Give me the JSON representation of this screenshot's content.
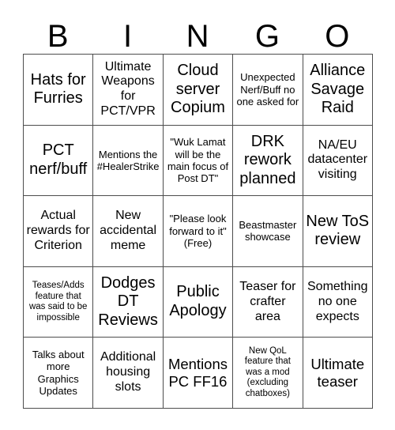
{
  "card": {
    "header_letters": [
      "B",
      "I",
      "N",
      "G",
      "O"
    ],
    "rows": [
      [
        {
          "text": "Hats for Furries",
          "size": "xl"
        },
        {
          "text": "Ultimate Weapons for PCT/VPR",
          "size": "md"
        },
        {
          "text": "Cloud server Copium",
          "size": "xl"
        },
        {
          "text": "Unexpected Nerf/Buff no one asked for",
          "size": "sm"
        },
        {
          "text": "Alliance Savage Raid",
          "size": "xl"
        }
      ],
      [
        {
          "text": "PCT nerf/buff",
          "size": "xl"
        },
        {
          "text": "Mentions the #HealerStrike",
          "size": "sm"
        },
        {
          "text": "\"Wuk Lamat will be the main focus of Post DT\"",
          "size": "sm"
        },
        {
          "text": "DRK rework planned",
          "size": "xl"
        },
        {
          "text": "NA/EU datacenter visiting",
          "size": "md"
        }
      ],
      [
        {
          "text": "Actual rewards for Criterion",
          "size": "md"
        },
        {
          "text": "New accidental meme",
          "size": "md"
        },
        {
          "text": "\"Please look forward to it\" (Free)",
          "size": "sm"
        },
        {
          "text": "Beastmaster showcase",
          "size": "sm"
        },
        {
          "text": "New ToS review",
          "size": "xl"
        }
      ],
      [
        {
          "text": "Teases/Adds feature that was said to be impossible",
          "size": "xs"
        },
        {
          "text": "Dodges DT Reviews",
          "size": "xl"
        },
        {
          "text": "Public Apology",
          "size": "xl"
        },
        {
          "text": "Teaser for crafter area",
          "size": "md"
        },
        {
          "text": "Something no one expects",
          "size": "md"
        }
      ],
      [
        {
          "text": "Talks about more Graphics Updates",
          "size": "sm"
        },
        {
          "text": "Additional housing slots",
          "size": "md"
        },
        {
          "text": "Mentions PC FF16",
          "size": "lg"
        },
        {
          "text": "New QoL feature that was a mod (excluding chatboxes)",
          "size": "xs"
        },
        {
          "text": "Ultimate teaser",
          "size": "lg"
        }
      ]
    ]
  }
}
